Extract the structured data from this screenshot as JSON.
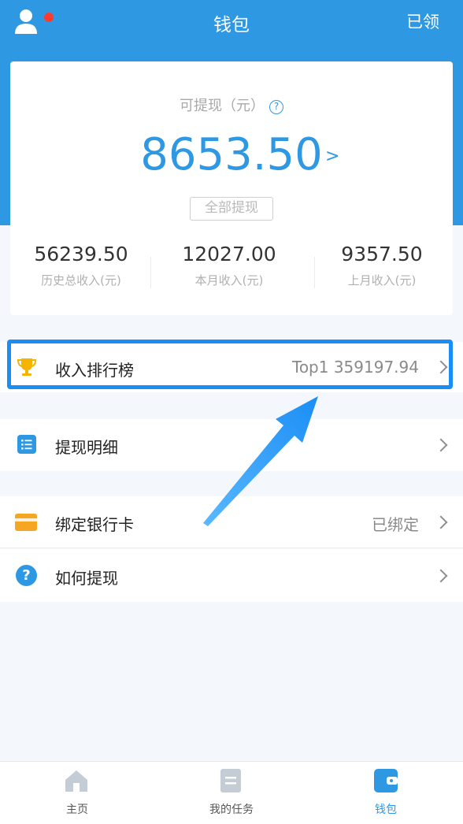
{
  "header": {
    "title": "钱包",
    "right_action": "已领"
  },
  "balance_card": {
    "available_label": "可提现（元）",
    "help_icon": "?",
    "amount": "8653.50",
    "amount_arrow": ">",
    "withdraw_all_label": "全部提现",
    "stats": [
      {
        "value": "56239.50",
        "label": "历史总收入(元)"
      },
      {
        "value": "12027.00",
        "label": "本月收入(元)"
      },
      {
        "value": "9357.50",
        "label": "上月收入(元)"
      }
    ]
  },
  "menu": {
    "ranking": {
      "label": "收入排行榜",
      "value": "Top1 359197.94",
      "icon": "trophy-icon"
    },
    "details": {
      "label": "提现明细",
      "icon": "list-icon"
    },
    "bank_card": {
      "label": "绑定银行卡",
      "value": "已绑定",
      "icon": "card-icon"
    },
    "how_to": {
      "label": "如何提现",
      "icon": "question-icon",
      "icon_glyph": "?"
    }
  },
  "tabbar": {
    "home": "主页",
    "tasks": "我的任务",
    "wallet": "钱包"
  },
  "colors": {
    "primary": "#2f98e3",
    "highlight": "#1b8ef5",
    "trophy": "#f5b400",
    "card": "#f5a623",
    "active_tab": "#2f98e3",
    "inactive_tab": "#c4ccd6"
  }
}
